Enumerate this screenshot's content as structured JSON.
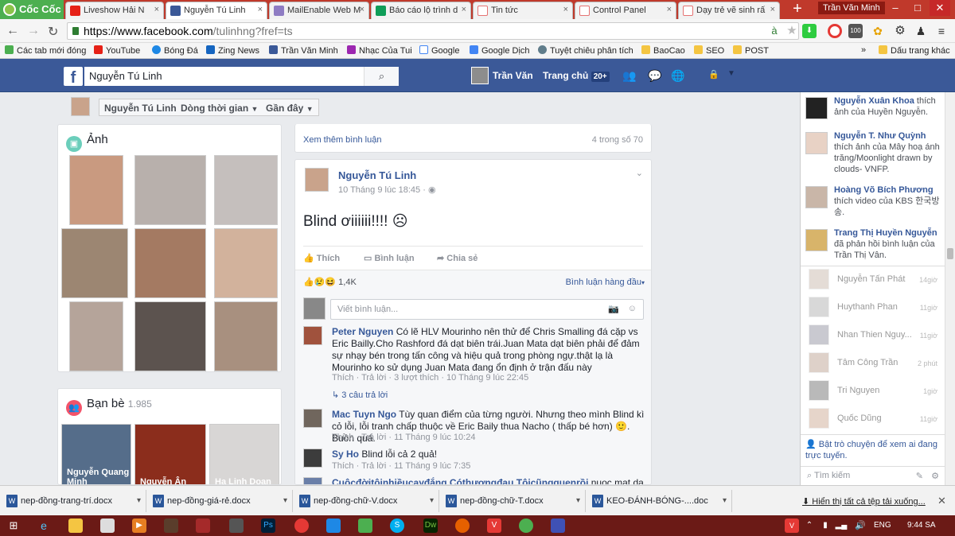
{
  "browser": {
    "brand": "Cốc Cốc",
    "tabs": [
      {
        "title": "Liveshow Hải N",
        "color": "#e62117"
      },
      {
        "title": "Nguyễn Tú Linh",
        "color": "#3b5998"
      },
      {
        "title": "MailEnable Web M",
        "color": "#8e7cc3"
      },
      {
        "title": "Báo cáo lộ trình d",
        "color": "#0f9d58"
      },
      {
        "title": "Tin tức",
        "color": "#e57373"
      },
      {
        "title": "Control Panel",
        "color": "#e57373"
      },
      {
        "title": "Dạy trẻ vẽ sinh rấ",
        "color": "#e57373"
      }
    ],
    "new_tab": "+",
    "user": "Trần Văn Minh",
    "url_domain": "https://www.facebook.com",
    "url_rest": "/tulinhng?fref=ts",
    "bookmarks": [
      "Các tab mới đóng",
      "YouTube",
      "Bóng Đá",
      "Zing News",
      "Trần Văn Minh",
      "Nhạc Của Tui",
      "Google",
      "Google Dịch",
      "Tuyệt chiêu phân tích",
      "BaoCao",
      "SEO",
      "POST"
    ],
    "bookmark_more": "»",
    "bookmark_folder": "Dấu trang khác",
    "ext_badge": "100"
  },
  "fb": {
    "logo": "f",
    "search_value": "Nguyễn Tú Linh",
    "user_short": "Trần Văn",
    "home": "Trang chủ",
    "home_count": "20+"
  },
  "profile": {
    "name": "Nguyễn Tú Linh",
    "timeline": "Dòng thời gian",
    "recent": "Gần đây",
    "photos_title": "Ảnh",
    "friends_title": "Bạn bè",
    "friends_count": "1.985",
    "friends": [
      "Nguyễn Quang Minh",
      "Nguyễn Ân",
      "Hạ Linh Doan"
    ]
  },
  "feed": {
    "more_comments": "Xem thêm bình luận",
    "more_count": "4 trong số 70",
    "post_author": "Nguyễn Tú Linh",
    "post_time": "10 Tháng 9 lúc 18:45 ·",
    "post_text": "Blind ơiiiiii!!!! ☹",
    "like": "Thích",
    "comment": "Bình luận",
    "share": "Chia sẻ",
    "reactions": "1,4K",
    "sort": "Bình luận hàng đầu",
    "write_placeholder": "Viết bình luận...",
    "comments": [
      {
        "name": "Peter Nguyen",
        "text": "Có lẽ HLV Mourinho nên thử để Chris Smalling đá cặp vs Eric Bailly.Cho Rashford đá dạt biên trái.Juan Mata dạt biên phải để đảm sự nhạy bén trong tấn công và hiệu quả trong phòng ngự.thật lạ là Mourinho ko sử dụng Juan Mata đang ổn định ở trận đấu này",
        "actions": "Thích · Trả lời · 3 lượt thích · 10 Tháng 9 lúc 22:45",
        "replies": "3 câu trả lời"
      },
      {
        "name": "Mac Tuyn Ngo",
        "text": "Tùy quan điểm của từng người. Nhưng theo mình Blind kì cỏ lỗi, lỗi tranh chấp thuộc về Eric Baily thua Nacho ( thấp bé hơn) 🙂. Buồn quá.",
        "actions": "Thích · Trả lời · 11 Tháng 9 lúc 10:24"
      },
      {
        "name": "Sy Ho",
        "text": "Blind lỗi cả 2 quả!",
        "actions": "Thích · Trả lời · 11 Tháng 9 lúc 7:35"
      },
      {
        "name": "Cuộcđờitôinhiềucayđắng Cóthươngđau Tôicũngquenrồi",
        "text": "nuoc mat da roi khi"
      }
    ]
  },
  "ticker": [
    {
      "name": "Nguyễn Xuân Khoa",
      "text": " thích ảnh của Huyền Nguyễn."
    },
    {
      "name": "Nguyễn T. Như Quỳnh",
      "text": " thích ảnh của Mây hoạ ánh trăng/Moonlight drawn by clouds- VNFP."
    },
    {
      "name": "Hoàng Võ Bích Phương",
      "text": " thích video của KBS 한국방송."
    },
    {
      "name": "Trang Thị Huyền Nguyễn",
      "text": " đã phản hồi bình luận của Trần Thị Vân."
    }
  ],
  "chat": {
    "friends": [
      {
        "name": "Nguyễn Tấn Phát",
        "time": "14giờ"
      },
      {
        "name": "Huythanh Phan",
        "time": "11giờ"
      },
      {
        "name": "Nhan Thien Nguy...",
        "time": "11giờ"
      },
      {
        "name": "Tâm Công Trần",
        "time": "2 phút"
      },
      {
        "name": "Tri Nguyen",
        "time": "1giờ"
      },
      {
        "name": "Quốc Dũng",
        "time": "11giờ"
      }
    ],
    "enable_text": "Bật trò chuyện để xem ai đang trực tuyến.",
    "search_placeholder": "Tìm kiếm"
  },
  "downloads": {
    "files": [
      "nep-đồng-trang-trí.docx",
      "nep-đồng-giá-rẻ.docx",
      "nep-đồng-chữ-V.docx",
      "nep-đồng-chữ-T.docx",
      "KEO-ĐÁNH-BÓNG-....doc"
    ],
    "show_all": "Hiển thị tất cả tệp tải xuống..."
  },
  "taskbar": {
    "lang": "ENG",
    "time": "9:44 SA"
  }
}
